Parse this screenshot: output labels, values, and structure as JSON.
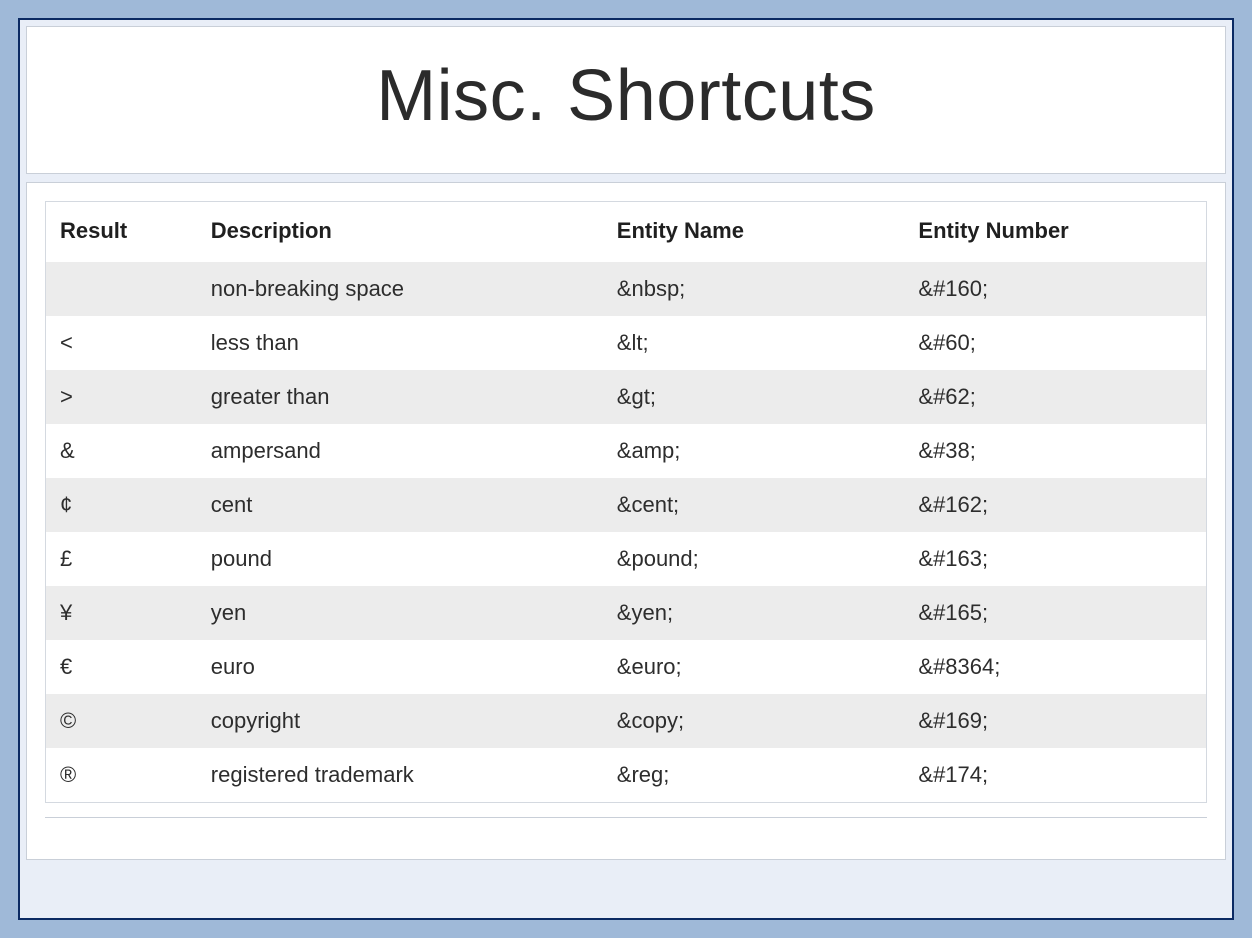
{
  "title": "Misc. Shortcuts",
  "table": {
    "headers": {
      "result": "Result",
      "description": "Description",
      "entity_name": "Entity Name",
      "entity_number": "Entity Number"
    },
    "rows": [
      {
        "result": "",
        "description": "non-breaking space",
        "entity_name": "&nbsp;",
        "entity_number": "&#160;"
      },
      {
        "result": "<",
        "description": "less than",
        "entity_name": "&lt;",
        "entity_number": "&#60;"
      },
      {
        "result": ">",
        "description": "greater than",
        "entity_name": "&gt;",
        "entity_number": "&#62;"
      },
      {
        "result": "&",
        "description": "ampersand",
        "entity_name": "&amp;",
        "entity_number": "&#38;"
      },
      {
        "result": "¢",
        "description": "cent",
        "entity_name": "&cent;",
        "entity_number": "&#162;"
      },
      {
        "result": "£",
        "description": "pound",
        "entity_name": "&pound;",
        "entity_number": "&#163;"
      },
      {
        "result": "¥",
        "description": "yen",
        "entity_name": "&yen;",
        "entity_number": "&#165;"
      },
      {
        "result": "€",
        "description": "euro",
        "entity_name": "&euro;",
        "entity_number": "&#8364;"
      },
      {
        "result": "©",
        "description": "copyright",
        "entity_name": "&copy;",
        "entity_number": "&#169;"
      },
      {
        "result": "®",
        "description": "registered trademark",
        "entity_name": "&reg;",
        "entity_number": "&#174;"
      }
    ]
  },
  "chart_data": {
    "type": "table",
    "title": "Misc. Shortcuts",
    "columns": [
      "Result",
      "Description",
      "Entity Name",
      "Entity Number"
    ],
    "rows": [
      [
        "",
        "non-breaking space",
        "&nbsp;",
        "&#160;"
      ],
      [
        "<",
        "less than",
        "&lt;",
        "&#60;"
      ],
      [
        ">",
        "greater than",
        "&gt;",
        "&#62;"
      ],
      [
        "&",
        "ampersand",
        "&amp;",
        "&#38;"
      ],
      [
        "¢",
        "cent",
        "&cent;",
        "&#162;"
      ],
      [
        "£",
        "pound",
        "&pound;",
        "&#163;"
      ],
      [
        "¥",
        "yen",
        "&yen;",
        "&#165;"
      ],
      [
        "€",
        "euro",
        "&euro;",
        "&#8364;"
      ],
      [
        "©",
        "copyright",
        "&copy;",
        "&#169;"
      ],
      [
        "®",
        "registered trademark",
        "&reg;",
        "&#174;"
      ]
    ]
  }
}
